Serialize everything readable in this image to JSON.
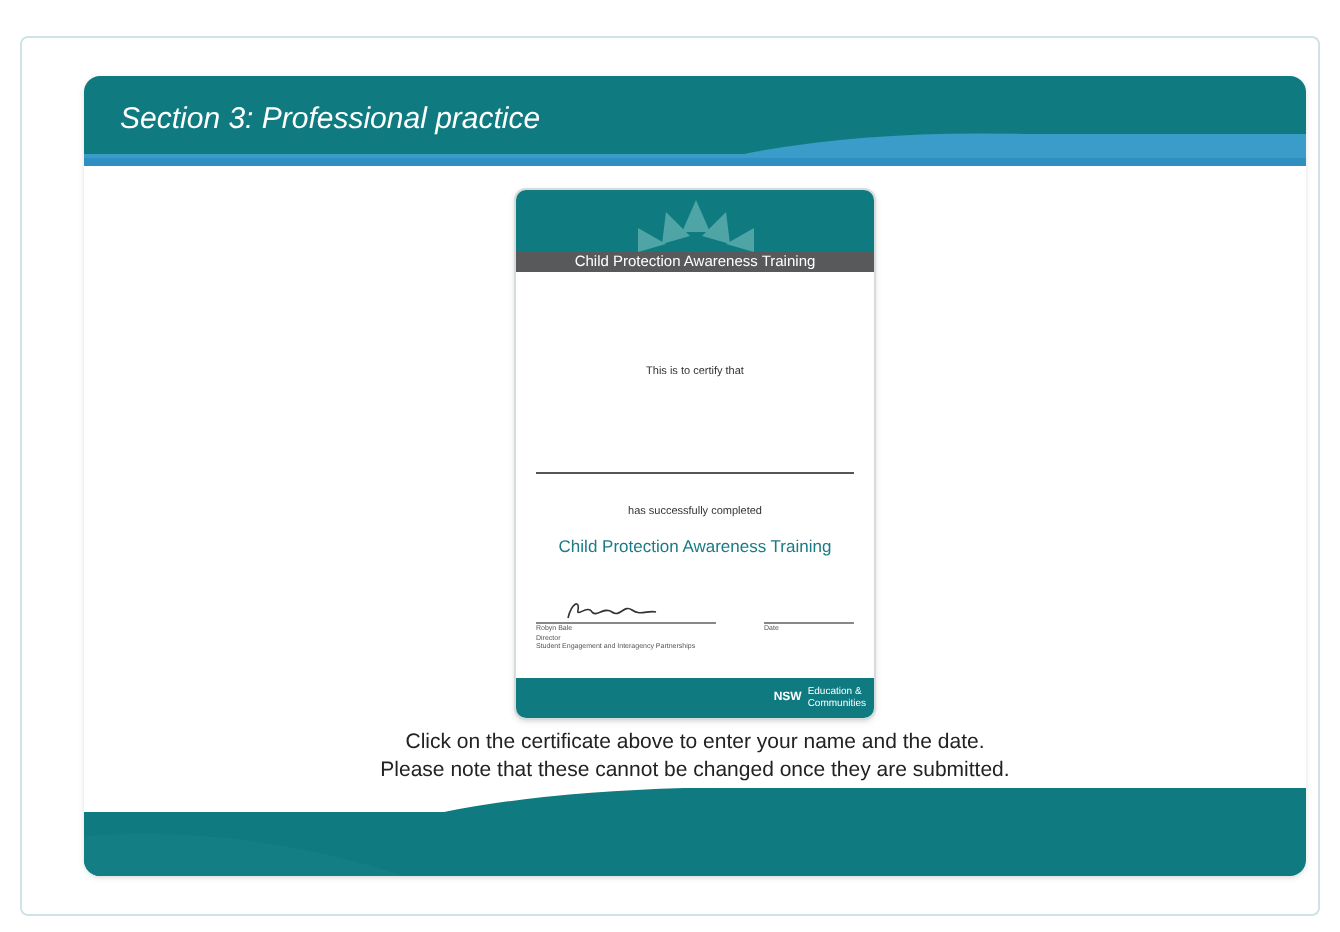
{
  "slide": {
    "title": "Section 3: Professional practice"
  },
  "certificate": {
    "title": "Child Protection Awareness Training",
    "intro": "This is to certify that",
    "completed": "has successfully completed",
    "course": "Child Protection Awareness Training",
    "signatory": [
      "Robyn Bale",
      "Director",
      "Student Engagement and Interagency Partnerships"
    ],
    "date_label": "Date",
    "logo_text": "NSW",
    "department": [
      "Education &",
      "Communities"
    ]
  },
  "instructions": [
    "Click on the certificate above to enter your name and the date.",
    "Please note that these cannot be changed once they are submitted."
  ]
}
